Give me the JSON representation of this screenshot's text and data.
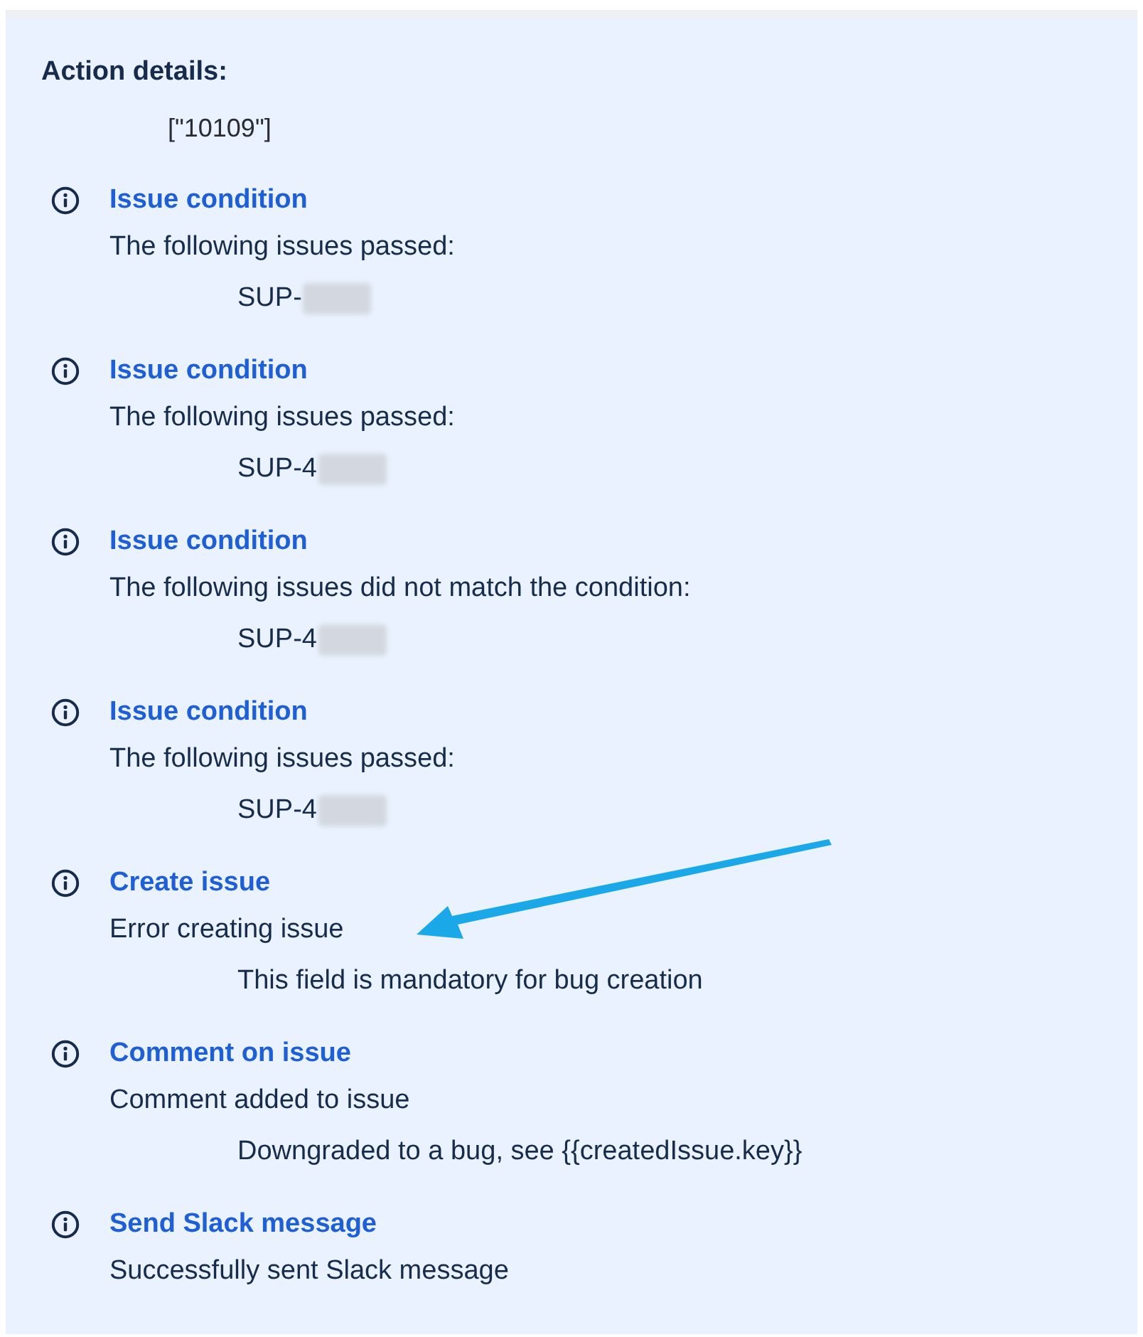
{
  "section_title": "Action details:",
  "action_value": "[\"10109\"]",
  "entries": [
    {
      "title": "Issue condition",
      "message": "The following issues passed:",
      "detail": "SUP-",
      "redacted": true
    },
    {
      "title": "Issue condition",
      "message": "The following issues passed:",
      "detail": "SUP-4",
      "redacted": true
    },
    {
      "title": "Issue condition",
      "message": "The following issues did not match the condition:",
      "detail": "SUP-4",
      "redacted": true
    },
    {
      "title": "Issue condition",
      "message": "The following issues passed:",
      "detail": "SUP-4",
      "redacted": true
    },
    {
      "title": "Create issue",
      "message": "Error creating issue",
      "detail": "This field is mandatory for bug creation",
      "redacted": false
    },
    {
      "title": "Comment on issue",
      "message": "Comment added to issue",
      "detail": "Downgraded to a bug, see {{createdIssue.key}}",
      "redacted": false
    },
    {
      "title": "Send Slack message",
      "message": "Successfully sent Slack message",
      "redacted": false
    }
  ],
  "annotation": {
    "kind": "arrow"
  }
}
